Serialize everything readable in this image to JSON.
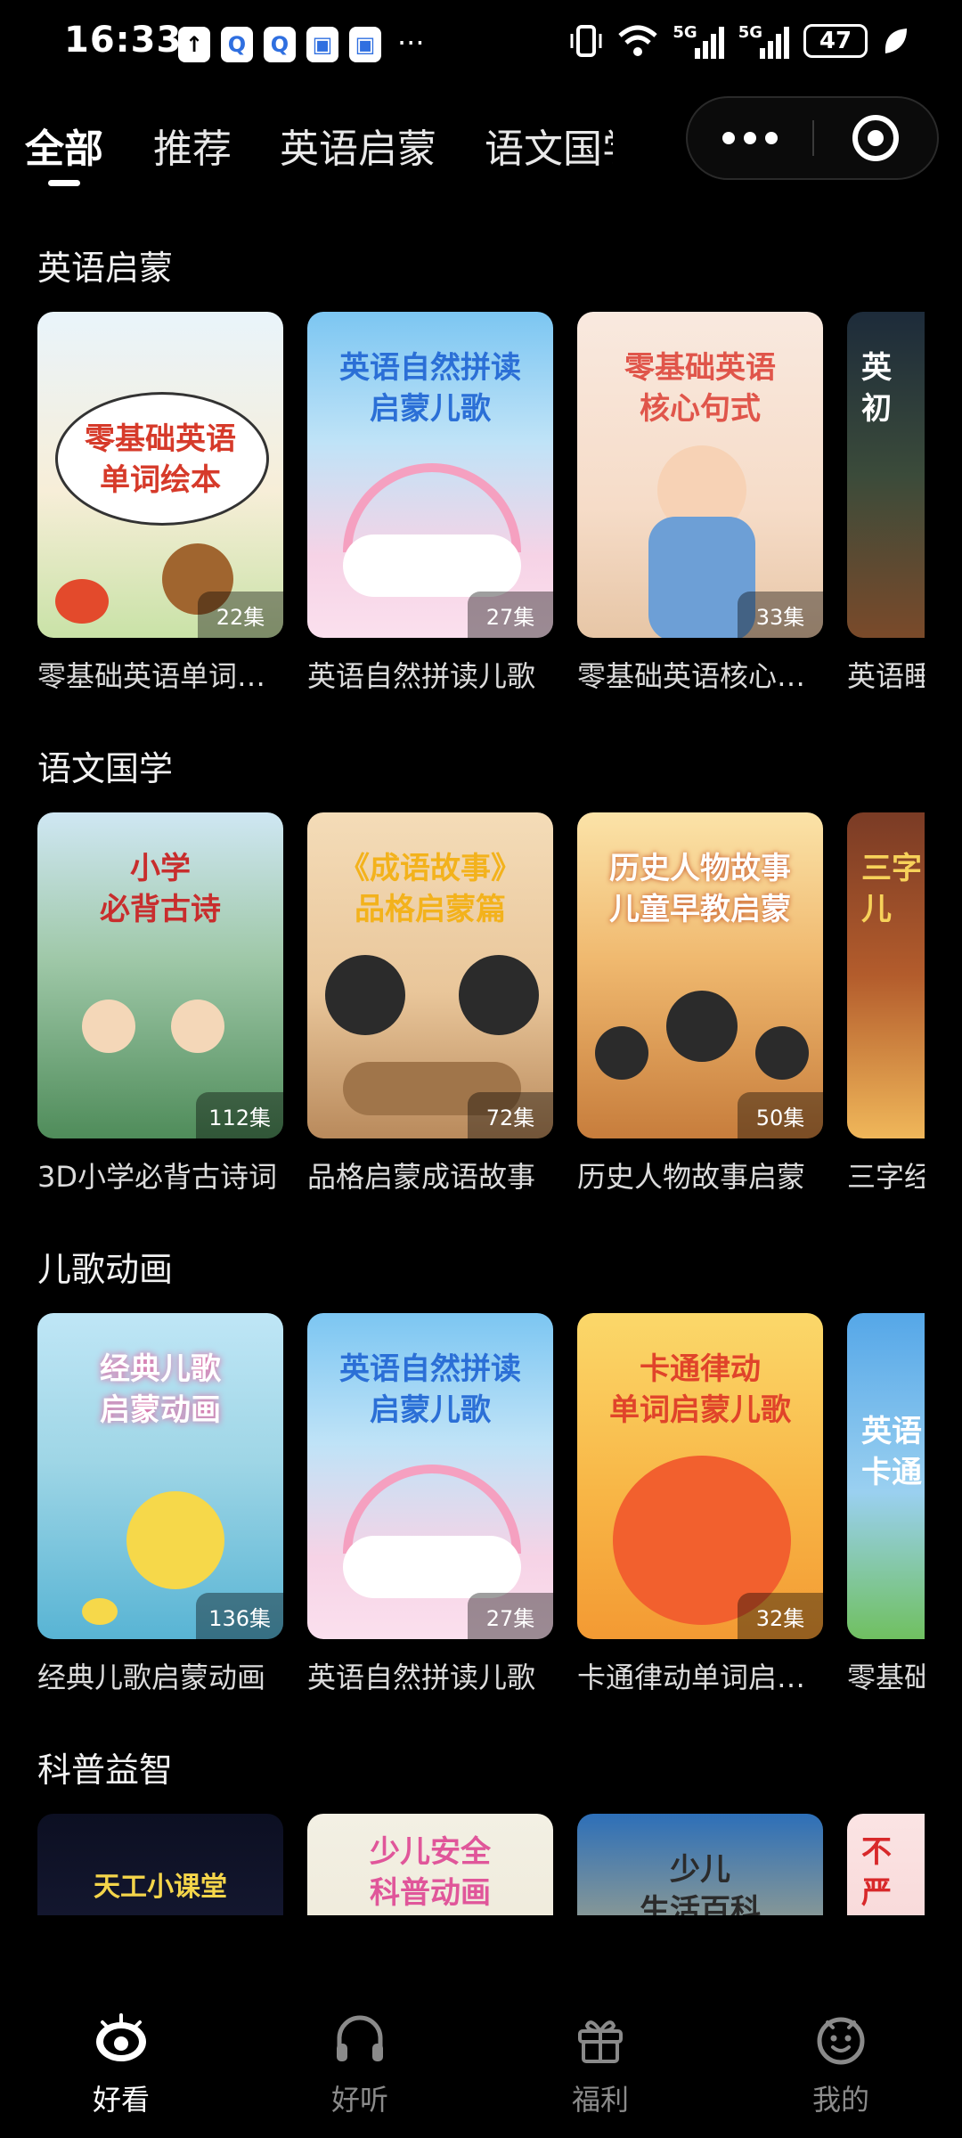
{
  "status_bar": {
    "time": "16:33",
    "network_1": "5G",
    "network_2": "5G",
    "battery": "47",
    "more_glyph": "···"
  },
  "top_tabs": [
    {
      "label": "全部",
      "active": true
    },
    {
      "label": "推荐",
      "active": false
    },
    {
      "label": "英语启蒙",
      "active": false
    },
    {
      "label": "语文国学",
      "active": false
    }
  ],
  "capsule": {
    "more_icon": "ellipsis-icon",
    "close_icon": "target-close-icon"
  },
  "sections": [
    {
      "title": "英语启蒙",
      "items": [
        {
          "title": "零基础英语单词绘本",
          "episodes": "22集",
          "poster_text": "零基础英语\n单词绘本"
        },
        {
          "title": "英语自然拼读儿歌",
          "episodes": "27集",
          "poster_text": "英语自然拼读\n启蒙儿歌"
        },
        {
          "title": "零基础英语核心句式",
          "episodes": "33集",
          "poster_text": "零基础英语\n核心句式"
        },
        {
          "title": "英语睡",
          "episodes": "",
          "poster_text": "英\n初"
        }
      ]
    },
    {
      "title": "语文国学",
      "items": [
        {
          "title": "3D小学必背古诗词",
          "episodes": "112集",
          "poster_text": "小学\n必背古诗"
        },
        {
          "title": "品格启蒙成语故事",
          "episodes": "72集",
          "poster_text": "《成语故事》\n品格启蒙篇"
        },
        {
          "title": "历史人物故事启蒙",
          "episodes": "50集",
          "poster_text": "历史人物故事\n儿童早教启蒙"
        },
        {
          "title": "三字经",
          "episodes": "",
          "poster_text": "三字\n儿"
        }
      ]
    },
    {
      "title": "儿歌动画",
      "items": [
        {
          "title": "经典儿歌启蒙动画",
          "episodes": "136集",
          "poster_text": "经典儿歌\n启蒙动画"
        },
        {
          "title": "英语自然拼读儿歌",
          "episodes": "27集",
          "poster_text": "英语自然拼读\n启蒙儿歌"
        },
        {
          "title": "卡通律动单词启蒙儿歌",
          "episodes": "32集",
          "poster_text": "卡通律动\n单词启蒙儿歌"
        },
        {
          "title": "零基础",
          "episodes": "",
          "poster_text": "英语\n卡通"
        }
      ]
    },
    {
      "title": "科普益智",
      "items": [
        {
          "title": "",
          "episodes": "",
          "poster_text": "天工小课堂"
        },
        {
          "title": "",
          "episodes": "",
          "poster_text": "少儿安全\n科普动画"
        },
        {
          "title": "",
          "episodes": "",
          "poster_text": "少儿\n生活百科"
        },
        {
          "title": "",
          "episodes": "",
          "poster_text": "不\n严"
        }
      ]
    }
  ],
  "bottom_nav": [
    {
      "label": "好看",
      "icon": "eye-icon",
      "active": true
    },
    {
      "label": "好听",
      "icon": "headphones-icon",
      "active": false
    },
    {
      "label": "福利",
      "icon": "gift-icon",
      "active": false
    },
    {
      "label": "我的",
      "icon": "smiley-face-icon",
      "active": false
    }
  ]
}
